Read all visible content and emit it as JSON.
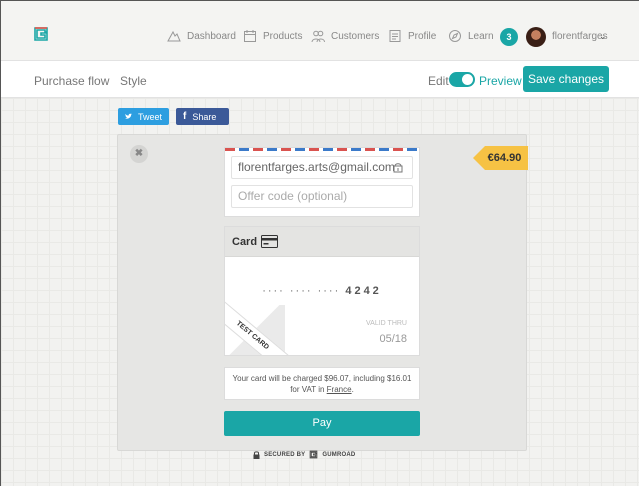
{
  "nav": {
    "items": [
      {
        "label": "Dashboard",
        "icon": "mountain-icon"
      },
      {
        "label": "Products",
        "icon": "calendar-icon"
      },
      {
        "label": "Customers",
        "icon": "people-icon"
      },
      {
        "label": "Profile",
        "icon": "profile-icon"
      },
      {
        "label": "Learn",
        "icon": "compass-icon"
      }
    ],
    "notification_count": "3",
    "username": "florentfarges",
    "user_chevron": "⌄"
  },
  "subbar": {
    "tab_purchase_flow": "Purchase flow",
    "tab_style": "Style",
    "edit_label": "Edit",
    "preview_label": "Preview",
    "preview_on": true,
    "save_label": "Save changes"
  },
  "social": {
    "tweet_label": "Tweet",
    "share_label": "Share"
  },
  "checkout": {
    "close_label": "✖",
    "price": "€64.90",
    "email_value": "florentfarges.arts@gmail.com",
    "offer_placeholder": "Offer code (optional)",
    "card_title": "Card",
    "card_dots": "···· ···· ····",
    "card_last4": "4242",
    "test_card_label": "TEST CARD",
    "valid_thru_label": "VALID THRU",
    "valid_thru_value": "05/18",
    "charge_text_1": "Your card will be charged $96.07, including $16.01",
    "charge_text_2": "for VAT in ",
    "charge_country": "France",
    "charge_text_3": ".",
    "pay_label": "Pay"
  },
  "footer": {
    "secured_label": "SECURED BY",
    "brand_label": "GUMROAD"
  },
  "colors": {
    "accent": "#1aa6a6",
    "price_tag": "#f6c244",
    "twitter": "#2d9ee0",
    "facebook": "#3b5998"
  }
}
